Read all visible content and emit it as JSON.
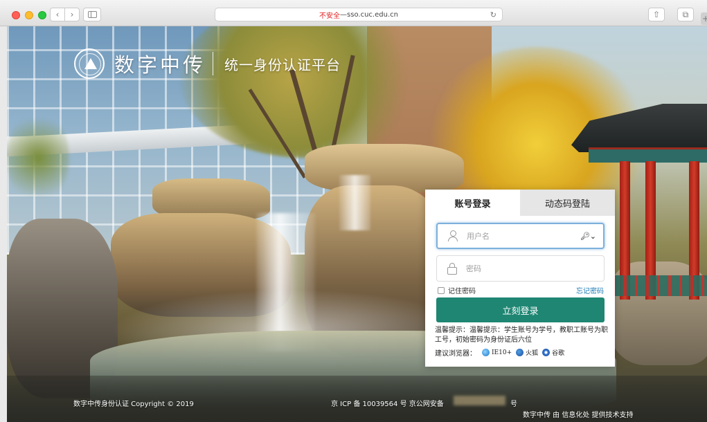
{
  "browser": {
    "insecure_label": "不安全",
    "url_sep": " — ",
    "url": "sso.cuc.edu.cn",
    "back_glyph": "‹",
    "forward_glyph": "›",
    "reload_glyph": "↻",
    "share_glyph": "⇧",
    "tabs_glyph": "⧉",
    "new_tab_glyph": "+"
  },
  "header": {
    "logo_name": "数字中传",
    "subtitle": "统一身份认证平台"
  },
  "login": {
    "tabs": [
      {
        "label": "账号登录",
        "active": true
      },
      {
        "label": "动态码登陆",
        "active": false
      }
    ],
    "username_placeholder": "用户名",
    "password_placeholder": "密码",
    "key_glyph": "🔑︎⌄",
    "remember_label": "记住密码",
    "forgot_label": "忘记密码",
    "submit_label": "立刻登录",
    "hint": "温馨提示：温馨提示：学生账号为学号，教职工账号为职工号，初始密码为身份证后六位",
    "browsers_label": "建议浏览器：",
    "browsers": [
      {
        "name": "IE10+",
        "icon": "ie-icon"
      },
      {
        "name": "火狐",
        "icon": "firefox-icon"
      },
      {
        "name": "谷歌",
        "icon": "chrome-icon"
      }
    ]
  },
  "footer": {
    "copyright": "数字中传身份认证 Copyright © 2019",
    "icp": "京 ICP 备 10039564 号 京公网安备",
    "icp_tail": "号",
    "support": "数字中传 由 信息化处 提供技术支持"
  },
  "colors": {
    "primary_button": "#1e8673",
    "link": "#1f7db5",
    "insecure": "#e02020"
  }
}
